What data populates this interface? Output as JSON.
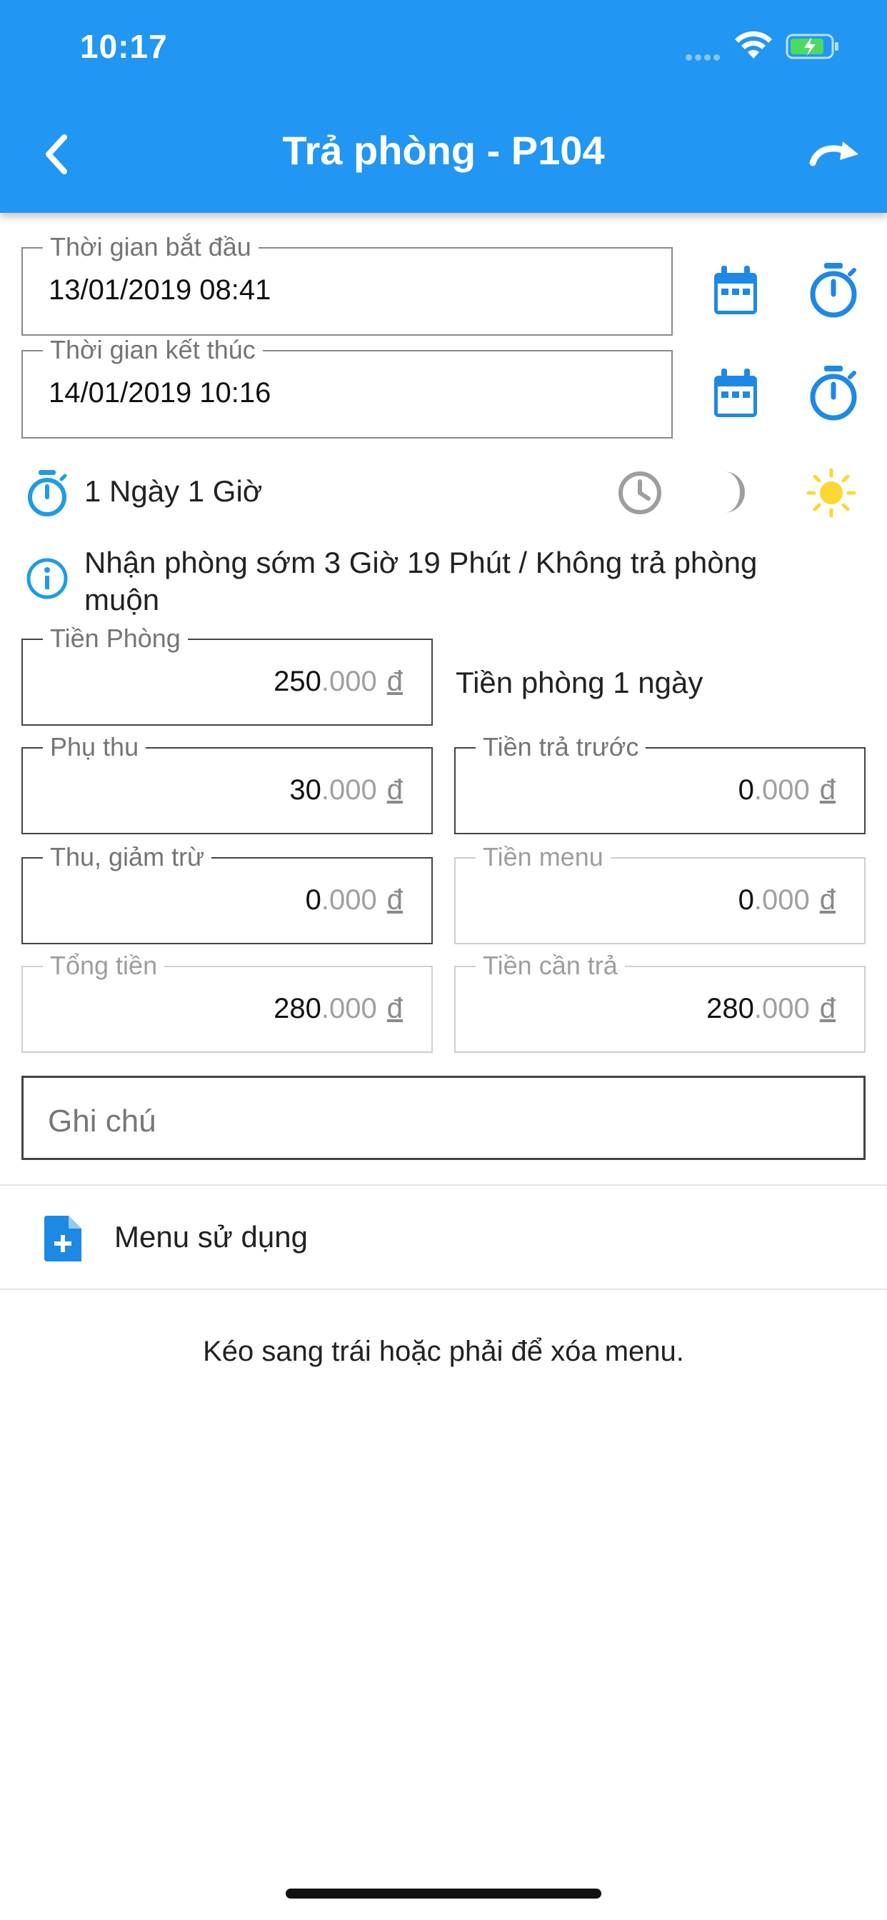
{
  "status_bar": {
    "time": "10:17"
  },
  "header": {
    "title": "Trả phòng - P104",
    "back_icon": "chevron-left-icon",
    "action_icon": "redo-icon"
  },
  "time": {
    "start": {
      "label": "Thời gian bắt đầu",
      "value": "13/01/2019 08:41"
    },
    "end": {
      "label": "Thời gian kết thúc",
      "value": "14/01/2019 10:16"
    }
  },
  "duration": {
    "text": "1 Ngày 1 Giờ",
    "modes": [
      "clock-icon",
      "moon-icon",
      "sun-icon"
    ],
    "active_mode": "sun-icon"
  },
  "info": {
    "text": "Nhận phòng sớm 3 Giờ 19 Phút / Không trả phòng muộn"
  },
  "money": {
    "decimals": ".000",
    "currency": "đ",
    "room_fee": {
      "label": "Tiền Phòng",
      "value": "250",
      "note": "Tiền phòng 1 ngày"
    },
    "surcharge": {
      "label": "Phụ thu",
      "value": "30"
    },
    "prepaid": {
      "label": "Tiền trả trước",
      "value": "0"
    },
    "deduction": {
      "label": "Thu, giảm trừ",
      "value": "0"
    },
    "menu_fee": {
      "label": "Tiền menu",
      "value": "0"
    },
    "total": {
      "label": "Tổng tiền",
      "value": "280"
    },
    "due": {
      "label": "Tiền cần trả",
      "value": "280"
    }
  },
  "note": {
    "placeholder": "Ghi chú"
  },
  "menu": {
    "label": "Menu sử dụng",
    "hint": "Kéo sang trái hoặc phải để xóa menu."
  },
  "colors": {
    "primary": "#2196f3",
    "accent_blue": "#1e88e5",
    "sun": "#fdd835",
    "muted": "#9e9e9e"
  }
}
